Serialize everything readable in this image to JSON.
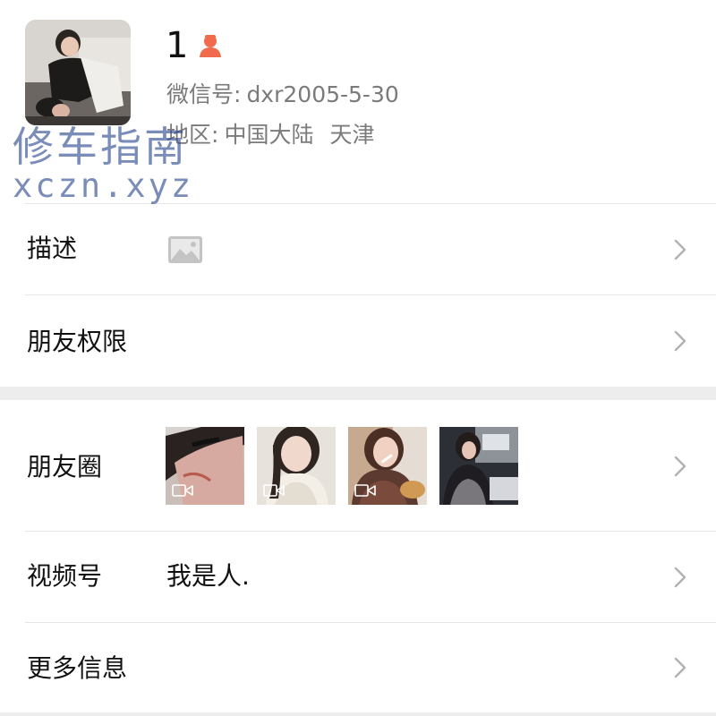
{
  "profile": {
    "name": "1",
    "gender_icon": "female-user-icon",
    "wechat_label": "微信号:",
    "wechat_id": "dxr2005-5-30",
    "region_label": "地区:",
    "region_country": "中国大陆",
    "region_city": "天津"
  },
  "watermark": {
    "line1": "修车指南",
    "line2": "xczn.xyz"
  },
  "rows": {
    "description": {
      "label": "描述",
      "icon": "image-placeholder-icon"
    },
    "permissions": {
      "label": "朋友权限"
    },
    "moments": {
      "label": "朋友圈",
      "thumbnail_count": 4,
      "thumbnail_icon": "video-camera-icon"
    },
    "channels": {
      "label": "视频号",
      "value": "我是人."
    },
    "more_info": {
      "label": "更多信息"
    }
  },
  "colors": {
    "accent_gender": "#f06a4d",
    "secondary_text": "#7b7b7b",
    "chevron": "#b2b2b2",
    "separator_band": "#ededed",
    "watermark": "#28468c"
  }
}
